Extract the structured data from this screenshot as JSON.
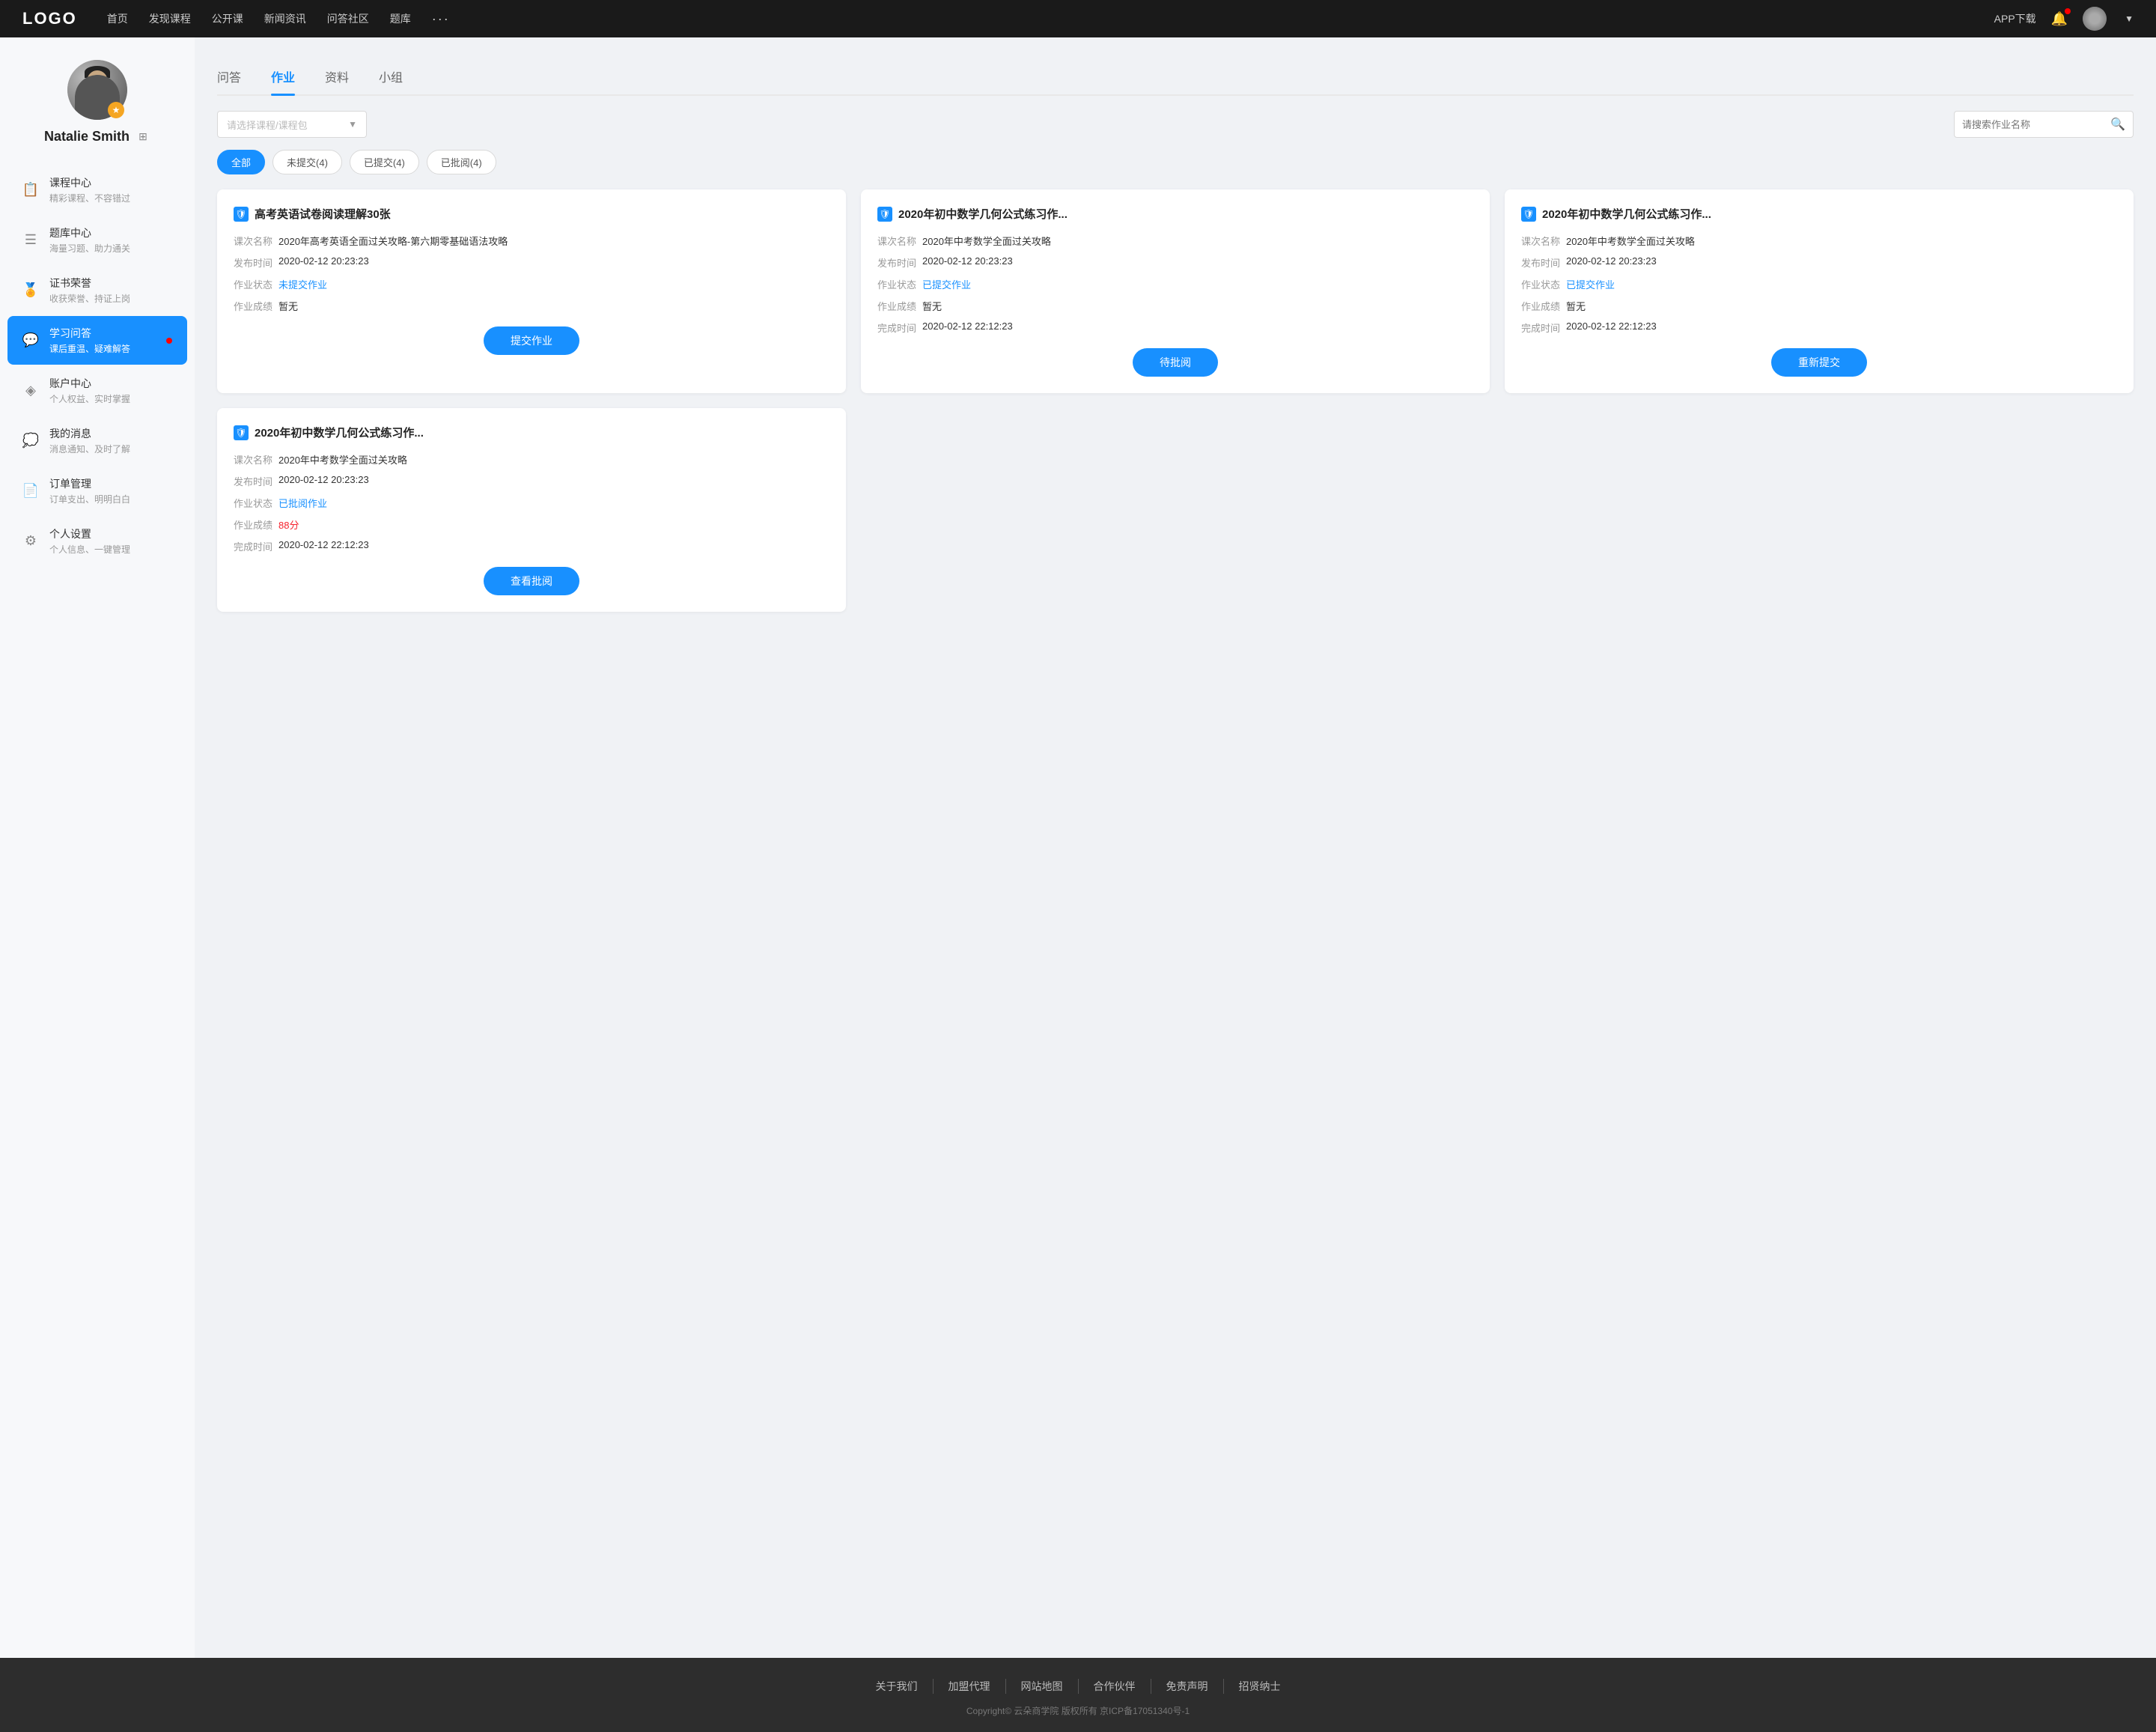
{
  "nav": {
    "logo": "LOGO",
    "links": [
      "首页",
      "发现课程",
      "公开课",
      "新闻资讯",
      "问答社区",
      "题库"
    ],
    "more": "···",
    "download": "APP下载"
  },
  "sidebar": {
    "profile": {
      "name": "Natalie Smith",
      "badge": "★"
    },
    "menu": [
      {
        "id": "course-center",
        "icon": "📋",
        "title": "课程中心",
        "sub": "精彩课程、不容错过",
        "active": false,
        "dot": false
      },
      {
        "id": "question-bank",
        "icon": "≡",
        "title": "题库中心",
        "sub": "海量习题、助力通关",
        "active": false,
        "dot": false
      },
      {
        "id": "certificate",
        "icon": "⚙",
        "title": "证书荣誉",
        "sub": "收获荣誉、持证上岗",
        "active": false,
        "dot": false
      },
      {
        "id": "qa",
        "icon": "💬",
        "title": "学习问答",
        "sub": "课后重温、疑难解答",
        "active": true,
        "dot": true
      },
      {
        "id": "account",
        "icon": "♦",
        "title": "账户中心",
        "sub": "个人权益、实时掌握",
        "active": false,
        "dot": false
      },
      {
        "id": "message",
        "icon": "💬",
        "title": "我的消息",
        "sub": "消息通知、及时了解",
        "active": false,
        "dot": false
      },
      {
        "id": "order",
        "icon": "📄",
        "title": "订单管理",
        "sub": "订单支出、明明白白",
        "active": false,
        "dot": false
      },
      {
        "id": "settings",
        "icon": "⚙",
        "title": "个人设置",
        "sub": "个人信息、一键管理",
        "active": false,
        "dot": false
      }
    ]
  },
  "tabs": [
    {
      "id": "qa",
      "label": "问答"
    },
    {
      "id": "homework",
      "label": "作业",
      "active": true
    },
    {
      "id": "material",
      "label": "资料"
    },
    {
      "id": "group",
      "label": "小组"
    }
  ],
  "filter": {
    "course_placeholder": "请选择课程/课程包",
    "search_placeholder": "请搜索作业名称"
  },
  "status_buttons": [
    {
      "label": "全部",
      "active": true
    },
    {
      "label": "未提交(4)",
      "active": false
    },
    {
      "label": "已提交(4)",
      "active": false
    },
    {
      "label": "已批阅(4)",
      "active": false
    }
  ],
  "cards": [
    {
      "title": "高考英语试卷阅读理解30张",
      "course_label": "课次名称",
      "course_value": "2020年高考英语全面过关攻略-第六期零基础语法攻略",
      "publish_label": "发布时间",
      "publish_value": "2020-02-12 20:23:23",
      "status_label": "作业状态",
      "status_value": "未提交作业",
      "status_type": "unsubmitted",
      "score_label": "作业成绩",
      "score_value": "暂无",
      "complete_label": "",
      "complete_value": "",
      "btn_label": "提交作业"
    },
    {
      "title": "2020年初中数学几何公式练习作...",
      "course_label": "课次名称",
      "course_value": "2020年中考数学全面过关攻略",
      "publish_label": "发布时间",
      "publish_value": "2020-02-12 20:23:23",
      "status_label": "作业状态",
      "status_value": "已提交作业",
      "status_type": "submitted",
      "score_label": "作业成绩",
      "score_value": "暂无",
      "complete_label": "完成时间",
      "complete_value": "2020-02-12 22:12:23",
      "btn_label": "待批阅"
    },
    {
      "title": "2020年初中数学几何公式练习作...",
      "course_label": "课次名称",
      "course_value": "2020年中考数学全面过关攻略",
      "publish_label": "发布时间",
      "publish_value": "2020-02-12 20:23:23",
      "status_label": "作业状态",
      "status_value": "已提交作业",
      "status_type": "submitted",
      "score_label": "作业成绩",
      "score_value": "暂无",
      "complete_label": "完成时间",
      "complete_value": "2020-02-12 22:12:23",
      "btn_label": "重新提交"
    },
    {
      "title": "2020年初中数学几何公式练习作...",
      "course_label": "课次名称",
      "course_value": "2020年中考数学全面过关攻略",
      "publish_label": "发布时间",
      "publish_value": "2020-02-12 20:23:23",
      "status_label": "作业状态",
      "status_value": "已批阅作业",
      "status_type": "submitted",
      "score_label": "作业成绩",
      "score_value": "88分",
      "score_type": "score",
      "complete_label": "完成时间",
      "complete_value": "2020-02-12 22:12:23",
      "btn_label": "查看批阅"
    }
  ],
  "footer": {
    "links": [
      "关于我们",
      "加盟代理",
      "网站地图",
      "合作伙伴",
      "免责声明",
      "招贤纳士"
    ],
    "copyright": "Copyright© 云朵商学院  版权所有    京ICP备17051340号-1"
  }
}
